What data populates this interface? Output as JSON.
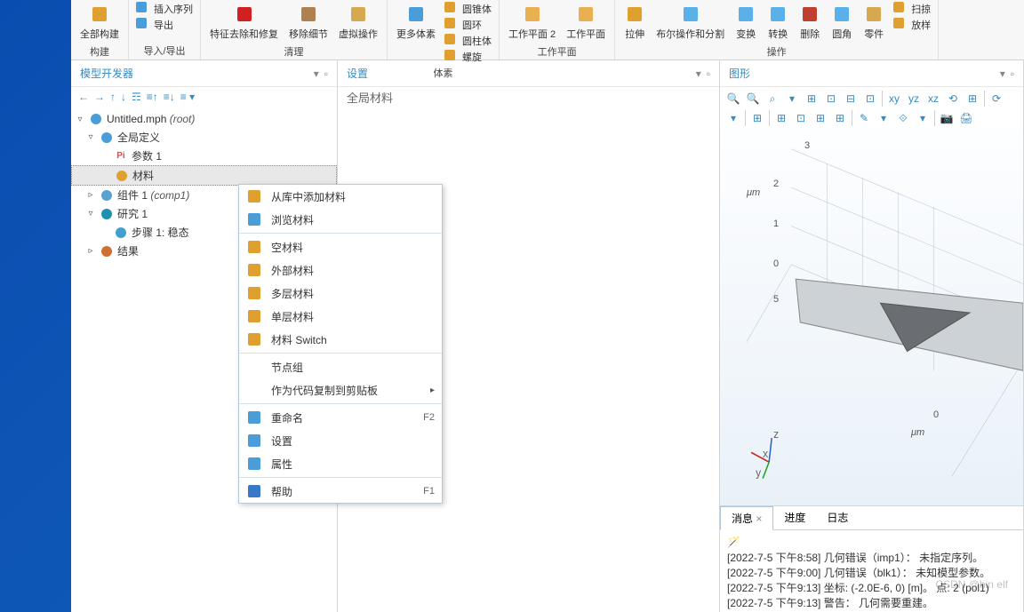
{
  "ribbon": {
    "groups": [
      {
        "label": "构建",
        "big": [
          {
            "t": "全部构建",
            "c": "#e0a030"
          }
        ],
        "small": []
      },
      {
        "label": "导入/导出",
        "big": [],
        "small": [
          {
            "t": "插入序列",
            "c": "#4a9dd8"
          },
          {
            "t": "导出",
            "c": "#4a9dd8"
          }
        ]
      },
      {
        "label": "清理",
        "big": [
          {
            "t": "特征去除和修复",
            "c": "#d02020"
          },
          {
            "t": "移除细节",
            "c": "#b08050"
          },
          {
            "t": "虚拟操作",
            "c": "#d8a850"
          }
        ],
        "small": []
      },
      {
        "label": "体素",
        "big": [
          {
            "t": "更多体素",
            "c": "#4a9dd8"
          }
        ],
        "small": [
          {
            "t": "圆锥体",
            "c": "#e0a030"
          },
          {
            "t": "圆环",
            "c": "#e0a030"
          },
          {
            "t": "圆柱体",
            "c": "#e0a030"
          },
          {
            "t": "螺旋",
            "c": "#e0a030"
          }
        ]
      },
      {
        "label": "工作平面",
        "big": [
          {
            "t": "工作平面 2",
            "c": "#e8b050"
          },
          {
            "t": "工作平面",
            "c": "#e8b050"
          }
        ],
        "small": []
      },
      {
        "label": "操作",
        "big": [
          {
            "t": "拉伸",
            "c": "#e0a030"
          },
          {
            "t": "布尔操作和分割",
            "c": "#5ab0e8"
          },
          {
            "t": "变换",
            "c": "#5ab0e8"
          },
          {
            "t": "转换",
            "c": "#5ab0e8"
          },
          {
            "t": "删除",
            "c": "#c04030"
          },
          {
            "t": "圆角",
            "c": "#5ab0e8"
          },
          {
            "t": "零件",
            "c": "#d8a850"
          }
        ],
        "small": [
          {
            "t": "扫掠",
            "c": "#e0a030"
          },
          {
            "t": "放样",
            "c": "#e0a030"
          }
        ]
      }
    ]
  },
  "panels": {
    "model": {
      "title": "模型开发器"
    },
    "settings": {
      "title": "设置",
      "sub": "全局材料"
    },
    "graphics": {
      "title": "图形"
    }
  },
  "tree": [
    {
      "depth": 0,
      "arrow": "▿",
      "ico": "#4a9dd8",
      "label": "Untitled.mph",
      "suffix": "(root)"
    },
    {
      "depth": 1,
      "arrow": "▿",
      "ico": "#4a9dd8",
      "label": "全局定义"
    },
    {
      "depth": 2,
      "arrow": "",
      "ico": "#e86868",
      "pre": "Pi",
      "label": "参数 1"
    },
    {
      "depth": 2,
      "arrow": "",
      "ico": "#e0a030",
      "label": "材料",
      "selected": true
    },
    {
      "depth": 1,
      "arrow": "▹",
      "ico": "#5aa0d0",
      "label": "组件 1",
      "suffix": "(comp1)"
    },
    {
      "depth": 1,
      "arrow": "▿",
      "ico": "#2090b0",
      "label": "研究 1"
    },
    {
      "depth": 2,
      "arrow": "",
      "ico": "#40a0d0",
      "label": "步骤 1: 稳态"
    },
    {
      "depth": 1,
      "arrow": "▹",
      "ico": "#d07030",
      "label": "结果"
    }
  ],
  "ctx": [
    {
      "t": "从库中添加材料",
      "c": "#e0a030"
    },
    {
      "t": "浏览材料",
      "c": "#4a9dd8"
    },
    {
      "sep": true
    },
    {
      "t": "空材料",
      "c": "#e0a030"
    },
    {
      "t": "外部材料",
      "c": "#e0a030"
    },
    {
      "t": "多层材料",
      "c": "#e0a030"
    },
    {
      "t": "单层材料",
      "c": "#e0a030"
    },
    {
      "t": "材料 Switch",
      "c": "#e0a030"
    },
    {
      "sep": true
    },
    {
      "t": "节点组"
    },
    {
      "t": "作为代码复制到剪贴板",
      "sub": true
    },
    {
      "sep": true
    },
    {
      "t": "重命名",
      "k": "F2",
      "c": "#4a9dd8"
    },
    {
      "t": "设置",
      "c": "#4a9dd8"
    },
    {
      "t": "属性",
      "c": "#4a9dd8"
    },
    {
      "sep": true
    },
    {
      "t": "帮助",
      "k": "F1",
      "c": "#3878c8"
    }
  ],
  "gfx": {
    "unit": "μm",
    "yticks": [
      "3",
      "2",
      "1",
      "0",
      "5"
    ],
    "xtick": "0",
    "axes": {
      "x": "x",
      "y": "y",
      "z": "z"
    },
    "toolbar": [
      "🔍",
      "🔍",
      "⌕",
      "▾",
      "⊞",
      "⊡",
      "⊟",
      "⊡",
      "|",
      "xy",
      "yz",
      "xz",
      "⟲",
      "⊞",
      "|",
      "⟳",
      "▾",
      "|",
      "⊞",
      "|",
      "⊞",
      "⊡",
      "⊞",
      "⊞",
      "|",
      "✎",
      "▾",
      "⟐",
      "▾",
      "|",
      "📷",
      "🖨"
    ]
  },
  "log": {
    "tabs": [
      "消息",
      "进度",
      "日志"
    ],
    "lines": [
      "[2022-7-5 下午8:58] 几何错误（imp1）： 未指定序列。",
      "[2022-7-5 下午9:00] 几何错误（blk1）： 未知模型参数。",
      "[2022-7-5 下午9:13] 坐标: (-2.0E-6, 0) [m]。 点: 2 (pol1)",
      "[2022-7-5 下午9:13] 警告： 几何需要重建。"
    ]
  },
  "watermark": "CSDN @bin elf"
}
